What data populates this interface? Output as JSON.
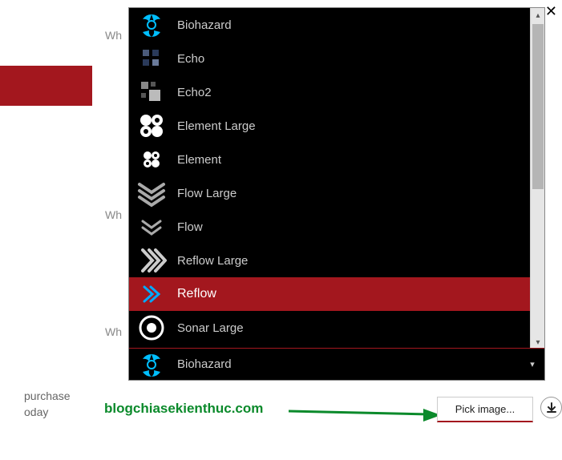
{
  "window": {
    "close_glyph": "✕"
  },
  "background": {
    "label_fragment": "Wh",
    "text_line1": "purchase",
    "text_line2": "oday"
  },
  "dropdown": {
    "items": [
      {
        "label": "Biohazard",
        "icon": "biohazard"
      },
      {
        "label": "Echo",
        "icon": "echo"
      },
      {
        "label": "Echo2",
        "icon": "echo2"
      },
      {
        "label": "Element Large",
        "icon": "element-large"
      },
      {
        "label": "Element",
        "icon": "element"
      },
      {
        "label": "Flow Large",
        "icon": "flow-large"
      },
      {
        "label": "Flow",
        "icon": "flow"
      },
      {
        "label": "Reflow Large",
        "icon": "reflow-large"
      },
      {
        "label": "Reflow",
        "icon": "reflow",
        "selected": true
      },
      {
        "label": "Sonar Large",
        "icon": "sonar-large"
      }
    ],
    "selected": {
      "label": "Biohazard",
      "icon": "biohazard",
      "caret": "▾"
    }
  },
  "watermark": "blogchiasekienthuc.com",
  "pick_button": "Pick image..."
}
